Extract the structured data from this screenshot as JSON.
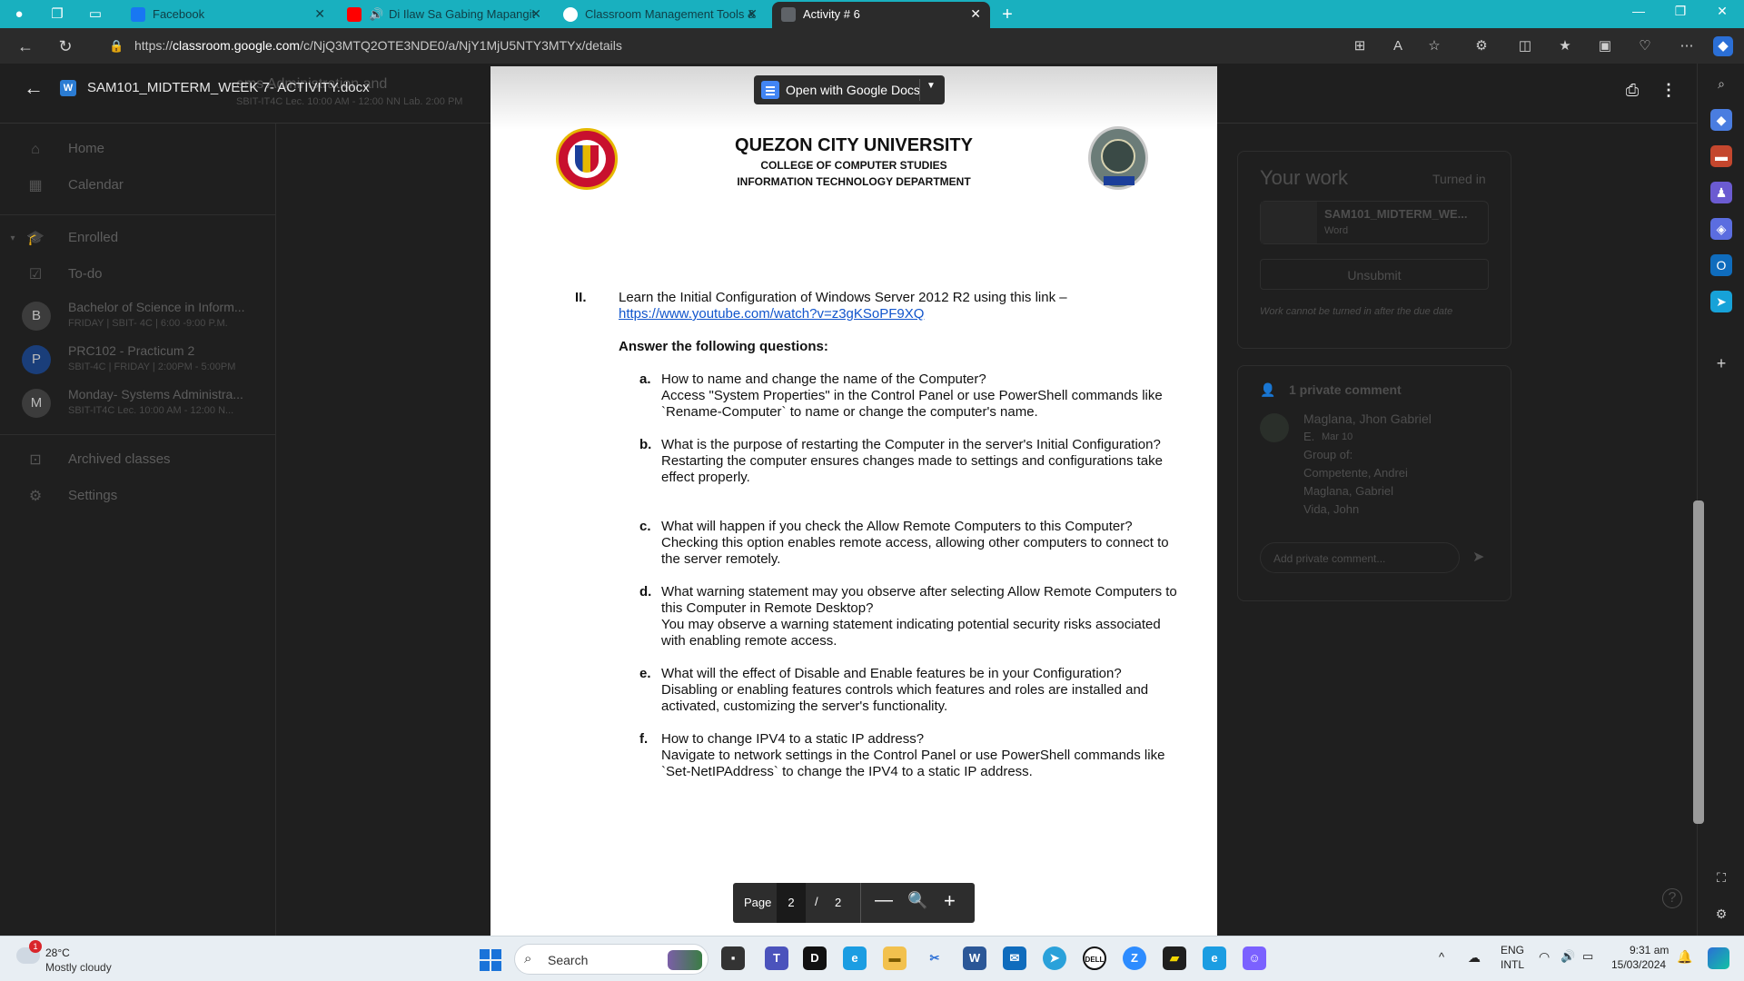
{
  "browser": {
    "tabs": [
      {
        "title": "Facebook"
      },
      {
        "title": "Di Ilaw Sa Gabing Mapangit"
      },
      {
        "title": "Classroom Management Tools &"
      },
      {
        "title": "Activity # 6"
      }
    ],
    "url_scheme": "https://",
    "url_host": "classroom.google.com",
    "url_path": "/c/NjQ3MTQ2OTE3NDE0/a/NjY1MjU5NTY3MTYx/details"
  },
  "classroom": {
    "class_title": "ems Administration and",
    "class_subtitle": "SBIT-IT4C Lec. 10:00 AM - 12:00 NN Lab. 2:00 PM",
    "sidebar": {
      "home": "Home",
      "calendar": "Calendar",
      "enrolled": "Enrolled",
      "todo": "To-do",
      "classes": [
        {
          "initial": "B",
          "name": "Bachelor of Science in Inform...",
          "sub": "FRIDAY | SBIT- 4C | 6:00 -9:00 P.M.",
          "color": "#3c3c3c"
        },
        {
          "initial": "P",
          "name": "PRC102 - Practicum 2",
          "sub": "SBIT-4C | FRIDAY | 2:00PM - 5:00PM",
          "color": "#1a3e7a"
        },
        {
          "initial": "M",
          "name": "Monday- Systems Administra...",
          "sub": "SBIT-IT4C Lec. 10:00 AM - 12:00 N...",
          "color": "#3c3c3c"
        }
      ],
      "archived": "Archived classes",
      "settings": "Settings"
    },
    "your_work": {
      "title": "Your work",
      "status": "Turned in",
      "file_name": "SAM101_MIDTERM_WE...",
      "file_type": "Word",
      "unsubmit": "Unsubmit",
      "note": "Work cannot be turned in after the due date"
    },
    "comments": {
      "heading": "1 private comment",
      "author": "Maglana, Jhon Gabriel",
      "author_suffix": "E.",
      "date": "Mar 10",
      "lines": [
        "Group of:",
        "Competente, Andrei",
        "Maglana, Gabriel",
        "Vida, John"
      ],
      "placeholder": "Add private comment..."
    }
  },
  "viewer": {
    "doc_title": "SAM101_MIDTERM_WEEK 7- ACTIVITY.docx",
    "open_with": "Open with Google Docs",
    "page_label": "Page",
    "current_page": "2",
    "page_sep": "/",
    "total_pages": "2"
  },
  "document": {
    "university": "QUEZON CITY UNIVERSITY",
    "college": "COLLEGE OF COMPUTER STUDIES",
    "department": "INFORMATION TECHNOLOGY DEPARTMENT",
    "section_number": "II.",
    "section_text": "Learn the Initial Configuration of Windows Server 2012 R2 using this link –",
    "section_link": "https://www.youtube.com/watch?v=z3gKSoPF9XQ",
    "answer_heading": "Answer the following questions:",
    "questions": [
      {
        "letter": "a.",
        "text": "How to name and change the name of the Computer?",
        "answer": "Access \"System Properties\" in the Control Panel or use PowerShell commands like `Rename-Computer` to name or change the computer's name."
      },
      {
        "letter": "b.",
        "text": "What is the purpose of restarting the Computer in the server's Initial Configuration?",
        "answer": "Restarting the computer ensures changes made to settings and configurations take effect properly."
      },
      {
        "letter": "c.",
        "text": "What will happen if you check the Allow Remote Computers to this Computer?",
        "answer": "Checking this option enables remote access, allowing other computers to connect to the server remotely."
      },
      {
        "letter": "d.",
        "text": "What warning statement may you observe after selecting Allow Remote Computers to this Computer in Remote Desktop?",
        "answer": "You may observe a warning statement indicating potential security risks associated with enabling remote access."
      },
      {
        "letter": "e.",
        "text": "What will the effect of Disable and Enable features be in your Configuration?",
        "answer": "Disabling or enabling features controls which features and roles are installed and activated, customizing the server's functionality."
      },
      {
        "letter": "f.",
        "text": "How to change IPV4 to a static IP address?",
        "answer": "Navigate to network settings in the Control Panel or use PowerShell commands like `Set-NetIPAddress` to change the IPV4 to a static IP address."
      }
    ]
  },
  "taskbar": {
    "weather_badge": "1",
    "temperature": "28°C",
    "condition": "Mostly cloudy",
    "search_placeholder": "Search",
    "lang_top": "ENG",
    "lang_bottom": "INTL",
    "time": "9:31 am",
    "date": "15/03/2024"
  },
  "colors": {
    "tab_strip": "#19b0bf",
    "link": "#1155cc",
    "viewer_bg": "#202124"
  }
}
